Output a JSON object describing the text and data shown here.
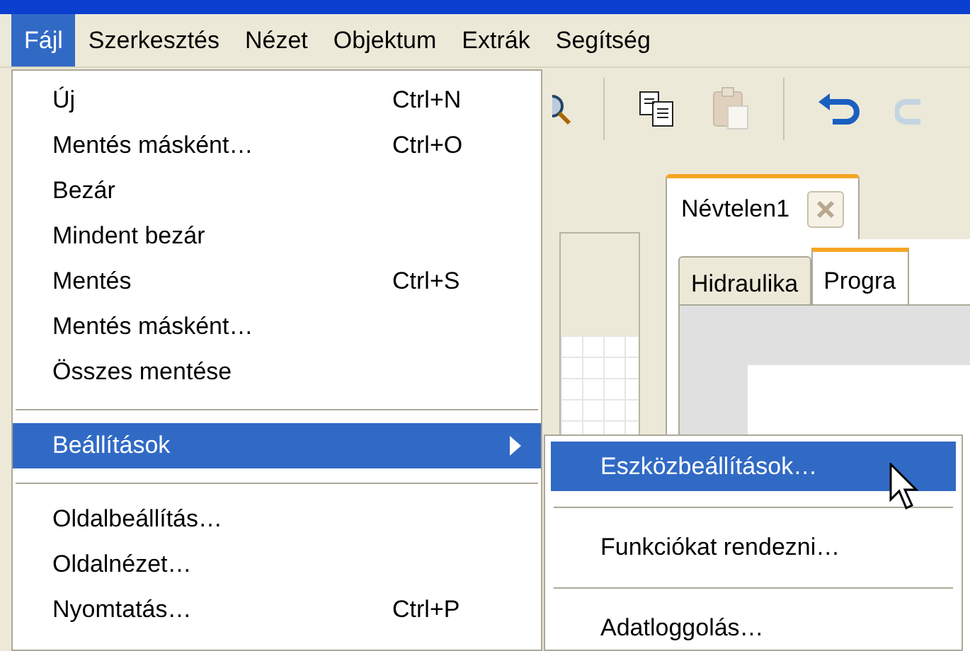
{
  "menubar": [
    {
      "label": "Fájl",
      "selected": true
    },
    {
      "label": "Szerkesztés",
      "selected": false
    },
    {
      "label": "Nézet",
      "selected": false
    },
    {
      "label": "Objektum",
      "selected": false
    },
    {
      "label": "Extrák",
      "selected": false
    },
    {
      "label": "Segítség",
      "selected": false
    }
  ],
  "toolbar": [
    {
      "kind": "zoom",
      "disabled": false
    },
    {
      "kind": "separator"
    },
    {
      "kind": "copy",
      "disabled": false
    },
    {
      "kind": "paste",
      "disabled": true
    },
    {
      "kind": "separator"
    },
    {
      "kind": "undo",
      "disabled": false
    },
    {
      "kind": "redo",
      "disabled": true
    }
  ],
  "document_tab": {
    "label": "Névtelen1"
  },
  "inner_tabs": [
    {
      "label": "Hidraulika",
      "selected": false
    },
    {
      "label": "Progra",
      "selected": true
    }
  ],
  "file_menu": [
    {
      "kind": "item",
      "label": "Új",
      "shortcut": "Ctrl+N",
      "selected": false
    },
    {
      "kind": "item",
      "label": "Mentés másként…",
      "shortcut": "Ctrl+O",
      "selected": false
    },
    {
      "kind": "item",
      "label": "Bezár",
      "selected": false
    },
    {
      "kind": "item",
      "label": "Mindent bezár",
      "selected": false
    },
    {
      "kind": "item",
      "label": "Mentés",
      "shortcut": "Ctrl+S",
      "selected": false
    },
    {
      "kind": "item",
      "label": "Mentés másként…",
      "selected": false
    },
    {
      "kind": "item",
      "label": "Összes mentése",
      "selected": false
    },
    {
      "kind": "separator"
    },
    {
      "kind": "submenu",
      "label": "Beállítások",
      "selected": true
    },
    {
      "kind": "separator"
    },
    {
      "kind": "item",
      "label": "Oldalbeállítás…",
      "selected": false
    },
    {
      "kind": "item",
      "label": "Oldalnézet…",
      "selected": false
    },
    {
      "kind": "item",
      "label": "Nyomtatás…",
      "shortcut": "Ctrl+P",
      "selected": false
    }
  ],
  "submenu": [
    {
      "kind": "item",
      "label": "Eszközbeállítások…",
      "selected": true
    },
    {
      "kind": "separator"
    },
    {
      "kind": "item",
      "label": "Funkciókat rendezni…",
      "selected": false
    },
    {
      "kind": "separator"
    },
    {
      "kind": "item",
      "label": "Adatloggolás…",
      "selected": false
    }
  ]
}
